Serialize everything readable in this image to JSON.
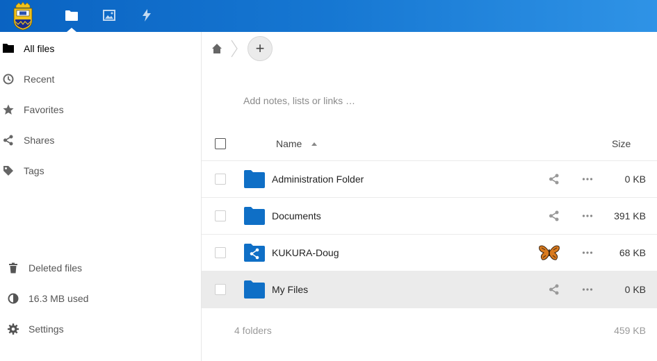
{
  "header": {
    "apps": [
      {
        "name": "Files",
        "icon": "folder-icon",
        "active": true
      },
      {
        "name": "Photos",
        "icon": "image-icon"
      },
      {
        "name": "Activity",
        "icon": "lightning-icon"
      }
    ],
    "colors": {
      "gradient_start": "#0a63c2",
      "gradient_end": "#2f93e6"
    }
  },
  "sidebar": {
    "items": [
      {
        "label": "All files",
        "icon": "folder-icon",
        "active": true
      },
      {
        "label": "Recent",
        "icon": "clock-icon"
      },
      {
        "label": "Favorites",
        "icon": "star-icon"
      },
      {
        "label": "Shares",
        "icon": "share-icon"
      },
      {
        "label": "Tags",
        "icon": "tag-icon"
      }
    ],
    "bottom": [
      {
        "label": "Deleted files",
        "icon": "trash-icon"
      },
      {
        "label": "16.3 MB used",
        "icon": "quota-pie-icon"
      },
      {
        "label": "Settings",
        "icon": "gear-icon"
      }
    ]
  },
  "main": {
    "add_label": "+",
    "notes_placeholder": "Add notes, lists or links …",
    "columns": {
      "name": "Name",
      "size": "Size"
    },
    "rows": [
      {
        "name": "Administration Folder",
        "size": "0 KB",
        "type": "folder",
        "highlighted": false
      },
      {
        "name": "Documents",
        "size": "391 KB",
        "type": "folder",
        "highlighted": false
      },
      {
        "name": "KUKURA-Doug",
        "size": "68 KB",
        "type": "shared-folder",
        "shared_by_avatar": "butterfly",
        "highlighted": false
      },
      {
        "name": "My Files",
        "size": "0 KB",
        "type": "folder",
        "highlighted": true
      }
    ],
    "summary": {
      "count": "4 folders",
      "total": "459 KB"
    },
    "colors": {
      "folder": "#0f6fc6",
      "highlight_row": "#ebebeb"
    }
  }
}
